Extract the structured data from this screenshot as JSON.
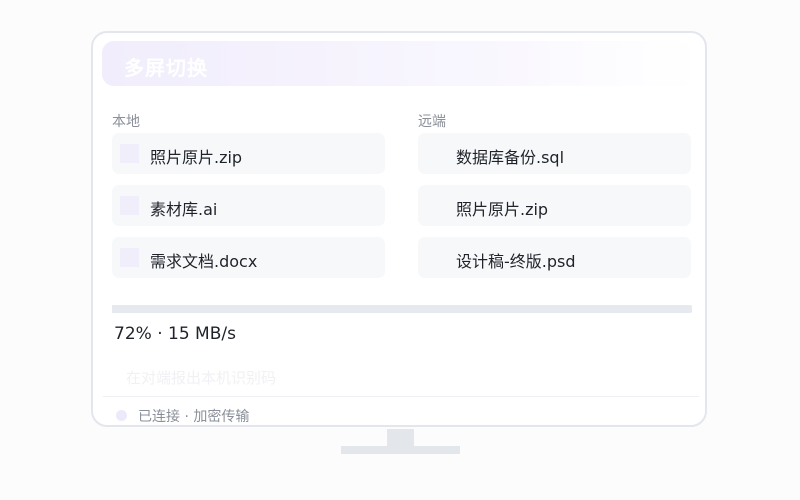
{
  "header": {
    "title": "多屏切换"
  },
  "local": {
    "label": "本地",
    "files": [
      {
        "name": "照片原片.zip"
      },
      {
        "name": "素材库.ai"
      },
      {
        "name": "需求文档.docx"
      }
    ]
  },
  "remote": {
    "label": "远端",
    "files": [
      {
        "name": "数据库备份.sql"
      },
      {
        "name": "照片原片.zip"
      },
      {
        "name": "设计稿-终版.psd"
      }
    ]
  },
  "transfer": {
    "progress_percent": 72,
    "text": "72% · 15 MB/s"
  },
  "hint": "在对端报出本机识别码",
  "status": "已连接 · 加密传输",
  "colors": {
    "accent_light": "#f1edfc",
    "border": "#e3e6ec",
    "file_bg": "#f7f8fa",
    "text_primary": "#1f2329",
    "text_muted": "#8a8f99"
  }
}
